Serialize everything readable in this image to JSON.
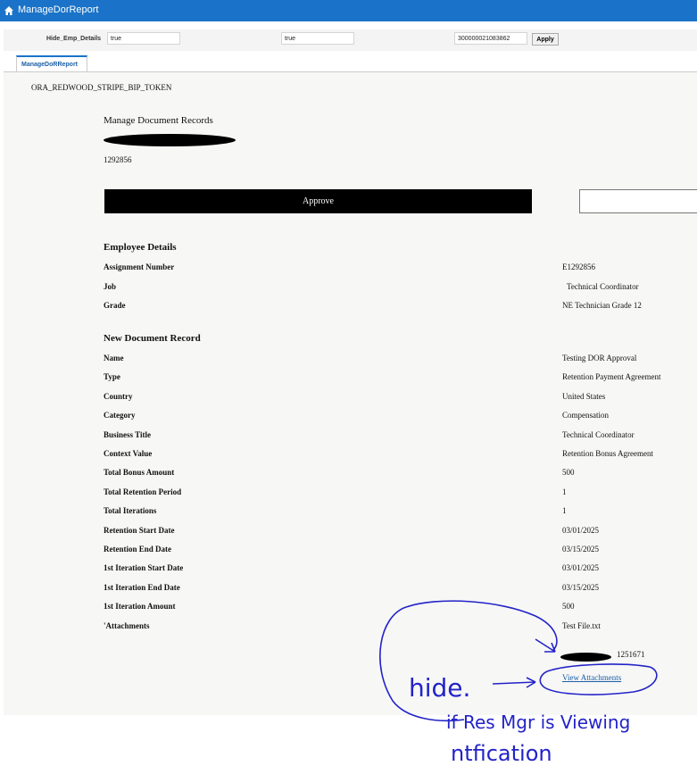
{
  "app": {
    "title": "ManageDorReport",
    "home_icon": "home-icon"
  },
  "params": {
    "label": "Hide_Emp_Details",
    "field1": "true",
    "field2": "true",
    "field3": "300000021083862",
    "apply_label": "Apply"
  },
  "tab": {
    "label": "ManageDoRReport"
  },
  "report": {
    "token": "ORA_REDWOOD_STRIPE_BIP_TOKEN",
    "heading": "Manage Document Records",
    "employee_number": "1292856",
    "approve_label": "Approve"
  },
  "employee_details": {
    "title": "Employee Details",
    "rows": [
      {
        "label": "Assignment Number",
        "value": "E1292856"
      },
      {
        "label": "Job",
        "value": "Technical Coordinator"
      },
      {
        "label": "Grade",
        "value": "NE Technician Grade 12"
      }
    ]
  },
  "document_record": {
    "title": "New Document Record",
    "rows": [
      {
        "label": "Name",
        "value": "Testing DOR Approval"
      },
      {
        "label": "Type",
        "value": "Retention Payment Agreement"
      },
      {
        "label": "Country",
        "value": "United States"
      },
      {
        "label": "Category",
        "value": "Compensation"
      },
      {
        "label": "Business Title",
        "value": "Technical Coordinator"
      },
      {
        "label": "Context Value",
        "value": "Retention Bonus Agreement"
      },
      {
        "label": "Total Bonus Amount",
        "value": "500"
      },
      {
        "label": "Total Retention Period",
        "value": "1"
      },
      {
        "label": "Total Iterations",
        "value": "1"
      },
      {
        "label": "Retention Start Date",
        "value": "03/01/2025"
      },
      {
        "label": "Retention End Date",
        "value": "03/15/2025"
      },
      {
        "label": "1st Iteration Start Date",
        "value": "03/01/2025"
      },
      {
        "label": "1st Iteration End Date",
        "value": "03/15/2025"
      },
      {
        "label": "1st Iteration Amount",
        "value": "500"
      },
      {
        "label": "'Attachments",
        "value": "Test File.txt"
      }
    ]
  },
  "manager_number": "1251671",
  "view_attachments_label": "View Attachments",
  "annotation": {
    "color": "#2323c8",
    "word1": "hide.",
    "line1": "if Res Mgr  is Viewing",
    "line2": "ntfication"
  }
}
